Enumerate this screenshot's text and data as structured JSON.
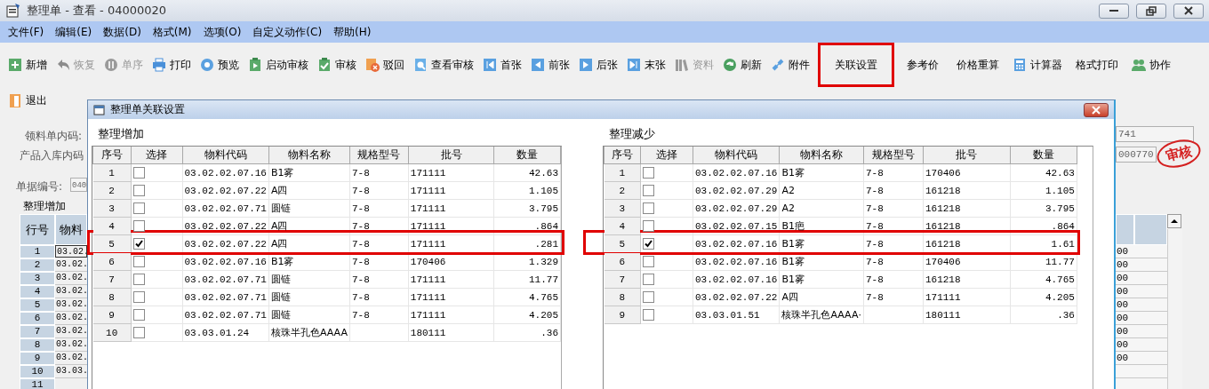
{
  "window": {
    "title": "整理单 - 查看 - 04000020"
  },
  "menu": [
    "文件(F)",
    "编辑(E)",
    "数据(D)",
    "格式(M)",
    "选项(O)",
    "自定义动作(C)",
    "帮助(H)"
  ],
  "toolbar_rows": [
    {
      "items": [
        {
          "label": "新增",
          "disabled": false,
          "highlighted": false
        },
        {
          "label": "恢复",
          "disabled": true,
          "highlighted": false
        },
        {
          "label": "单序",
          "disabled": true,
          "highlighted": false
        },
        {
          "label": "打印",
          "disabled": false,
          "highlighted": false
        },
        {
          "label": "预览",
          "disabled": false,
          "highlighted": false
        },
        {
          "label": "启动审核",
          "disabled": false,
          "highlighted": false
        },
        {
          "label": "审核",
          "disabled": false,
          "highlighted": false
        },
        {
          "label": "驳回",
          "disabled": false,
          "highlighted": false
        },
        {
          "label": "查看审核",
          "disabled": false,
          "highlighted": false
        },
        {
          "label": "首张",
          "disabled": false,
          "highlighted": false
        },
        {
          "label": "前张",
          "disabled": false,
          "highlighted": false
        },
        {
          "label": "后张",
          "disabled": false,
          "highlighted": false
        },
        {
          "label": "末张",
          "disabled": false,
          "highlighted": false
        },
        {
          "label": "资料",
          "disabled": true,
          "highlighted": false
        },
        {
          "label": "刷新",
          "disabled": false,
          "highlighted": false
        },
        {
          "label": "附件",
          "disabled": false,
          "highlighted": false
        },
        {
          "label": "关联设置",
          "disabled": false,
          "highlighted": true
        },
        {
          "label": "参考价",
          "disabled": false,
          "highlighted": false
        },
        {
          "label": "价格重算",
          "disabled": false,
          "highlighted": false
        },
        {
          "label": "计算器",
          "disabled": false,
          "highlighted": false
        },
        {
          "label": "格式打印",
          "disabled": false,
          "highlighted": false
        },
        {
          "label": "协作",
          "disabled": false,
          "highlighted": false
        }
      ]
    },
    {
      "items": [
        {
          "label": "退出",
          "disabled": false,
          "highlighted": false
        }
      ]
    }
  ],
  "form": {
    "labels": [
      "领料单内码:",
      "产品入库内码",
      "单据编号:"
    ],
    "doc_number": "040",
    "section_title": "整理增加",
    "grid": {
      "columns": [
        "行号",
        "物料"
      ],
      "rows": [
        {
          "row": "1",
          "cell": "03.02.",
          "selected": true
        },
        {
          "row": "2",
          "cell": "03.02.",
          "selected": false
        },
        {
          "row": "3",
          "cell": "03.02.",
          "selected": false
        },
        {
          "row": "4",
          "cell": "03.02.",
          "selected": false
        },
        {
          "row": "5",
          "cell": "03.02.",
          "selected": false
        },
        {
          "row": "6",
          "cell": "03.02.",
          "selected": false
        },
        {
          "row": "7",
          "cell": "03.02.",
          "selected": false
        },
        {
          "row": "8",
          "cell": "03.02.",
          "selected": false
        },
        {
          "row": "9",
          "cell": "03.02.",
          "selected": false
        },
        {
          "row": "10",
          "cell": "03.03.",
          "selected": false
        },
        {
          "row": "11",
          "selected": false
        }
      ]
    },
    "right_fields": [
      "741",
      "000770"
    ],
    "stamp": "审核",
    "right_cells": [
      "00",
      "00",
      "00",
      "00",
      "00",
      "00",
      "00",
      "00",
      "00"
    ]
  },
  "dialog": {
    "title": "整理单关联设置",
    "panels": [
      {
        "title": "整理增加",
        "columns": [
          "序号",
          "选择",
          "物料代码",
          "物料名称",
          "规格型号",
          "批号",
          "数量"
        ],
        "rows": [
          {
            "cells": [
              "1",
              "",
              "03.02.02.07.16",
              "B1雾",
              "7-8",
              "171111",
              "42.63"
            ],
            "checked": false,
            "highlighted": false
          },
          {
            "cells": [
              "2",
              "",
              "03.02.02.07.22",
              "A四",
              "7-8",
              "171111",
              "1.105"
            ],
            "checked": false,
            "highlighted": false
          },
          {
            "cells": [
              "3",
              "",
              "03.02.02.07.71",
              "圆链",
              "7-8",
              "171111",
              "3.795"
            ],
            "checked": false,
            "highlighted": false
          },
          {
            "cells": [
              "4",
              "",
              "03.02.02.07.22",
              "A四",
              "7-8",
              "171111",
              ".864"
            ],
            "checked": false,
            "highlighted": false
          },
          {
            "cells": [
              "5",
              "",
              "03.02.02.07.22",
              "A四",
              "7-8",
              "171111",
              ".281"
            ],
            "checked": true,
            "highlighted": true
          },
          {
            "cells": [
              "6",
              "",
              "03.02.02.07.16",
              "B1雾",
              "7-8",
              "170406",
              "1.329"
            ],
            "checked": false,
            "highlighted": false
          },
          {
            "cells": [
              "7",
              "",
              "03.02.02.07.71",
              "圆链",
              "7-8",
              "171111",
              "11.77"
            ],
            "checked": false,
            "highlighted": false
          },
          {
            "cells": [
              "8",
              "",
              "03.02.02.07.71",
              "圆链",
              "7-8",
              "171111",
              "4.765"
            ],
            "checked": false,
            "highlighted": false
          },
          {
            "cells": [
              "9",
              "",
              "03.02.02.07.71",
              "圆链",
              "7-8",
              "171111",
              "4.205"
            ],
            "checked": false,
            "highlighted": false
          },
          {
            "cells": [
              "10",
              "",
              "03.03.01.24",
              "核珠半孔色AAAA",
              "",
              "180111",
              ".36"
            ],
            "checked": false,
            "highlighted": false
          }
        ]
      },
      {
        "title": "整理减少",
        "columns": [
          "序号",
          "选择",
          "物料代码",
          "物料名称",
          "规格型号",
          "批号",
          "数量"
        ],
        "rows": [
          {
            "cells": [
              "1",
              "",
              "03.02.02.07.16",
              "B1雾",
              "7-8",
              "170406",
              "42.63"
            ],
            "checked": false,
            "highlighted": false
          },
          {
            "cells": [
              "2",
              "",
              "03.02.02.07.29",
              "A2",
              "7-8",
              "161218",
              "1.105"
            ],
            "checked": false,
            "highlighted": false
          },
          {
            "cells": [
              "3",
              "",
              "03.02.02.07.29",
              "A2",
              "7-8",
              "161218",
              "3.795"
            ],
            "checked": false,
            "highlighted": false
          },
          {
            "cells": [
              "4",
              "",
              "03.02.02.07.15",
              "B1疤",
              "7-8",
              "161218",
              ".864"
            ],
            "checked": false,
            "highlighted": false
          },
          {
            "cells": [
              "5",
              "",
              "03.02.02.07.16",
              "B1雾",
              "7-8",
              "161218",
              "1.61"
            ],
            "checked": true,
            "highlighted": true
          },
          {
            "cells": [
              "6",
              "",
              "03.02.02.07.16",
              "B1雾",
              "7-8",
              "170406",
              "11.77"
            ],
            "checked": false,
            "highlighted": false
          },
          {
            "cells": [
              "7",
              "",
              "03.02.02.07.16",
              "B1雾",
              "7-8",
              "161218",
              "4.765"
            ],
            "checked": false,
            "highlighted": false
          },
          {
            "cells": [
              "8",
              "",
              "03.02.02.07.22",
              "A四",
              "7-8",
              "171111",
              "4.205"
            ],
            "checked": false,
            "highlighted": false
          },
          {
            "cells": [
              "9",
              "",
              "03.03.01.51",
              "核珠半孔色AAAA·",
              "",
              "180111",
              ".36"
            ],
            "checked": false,
            "highlighted": false
          }
        ]
      }
    ]
  }
}
